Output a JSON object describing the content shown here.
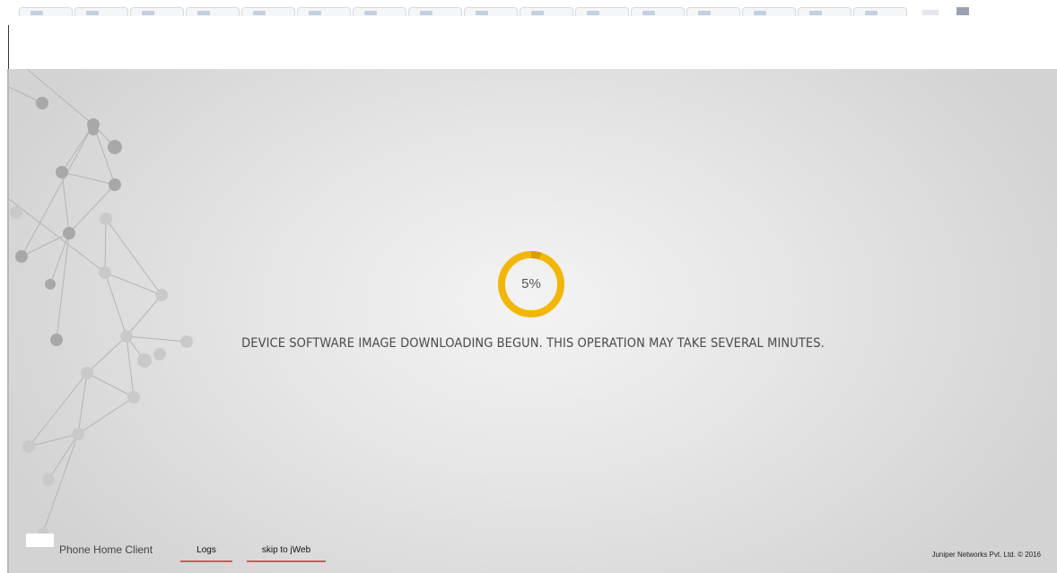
{
  "browser": {
    "tab_count": 16
  },
  "progress": {
    "percent": 5,
    "label": "5%",
    "ring_color": "#f2b705",
    "ring_track_color": "#d99e00"
  },
  "status": {
    "message": "DEVICE SOFTWARE IMAGE DOWNLOADING BEGUN. THIS OPERATION MAY TAKE SEVERAL MINUTES."
  },
  "footer": {
    "app_name": "Phone Home Client",
    "logs_link": "Logs",
    "skip_link": "skip to jWeb",
    "copyright": "Juniper Networks Pvt. Ltd. © 2016",
    "link_underline_color": "#e0525e"
  },
  "decor": {
    "background_icon": "network-graph-icon"
  }
}
